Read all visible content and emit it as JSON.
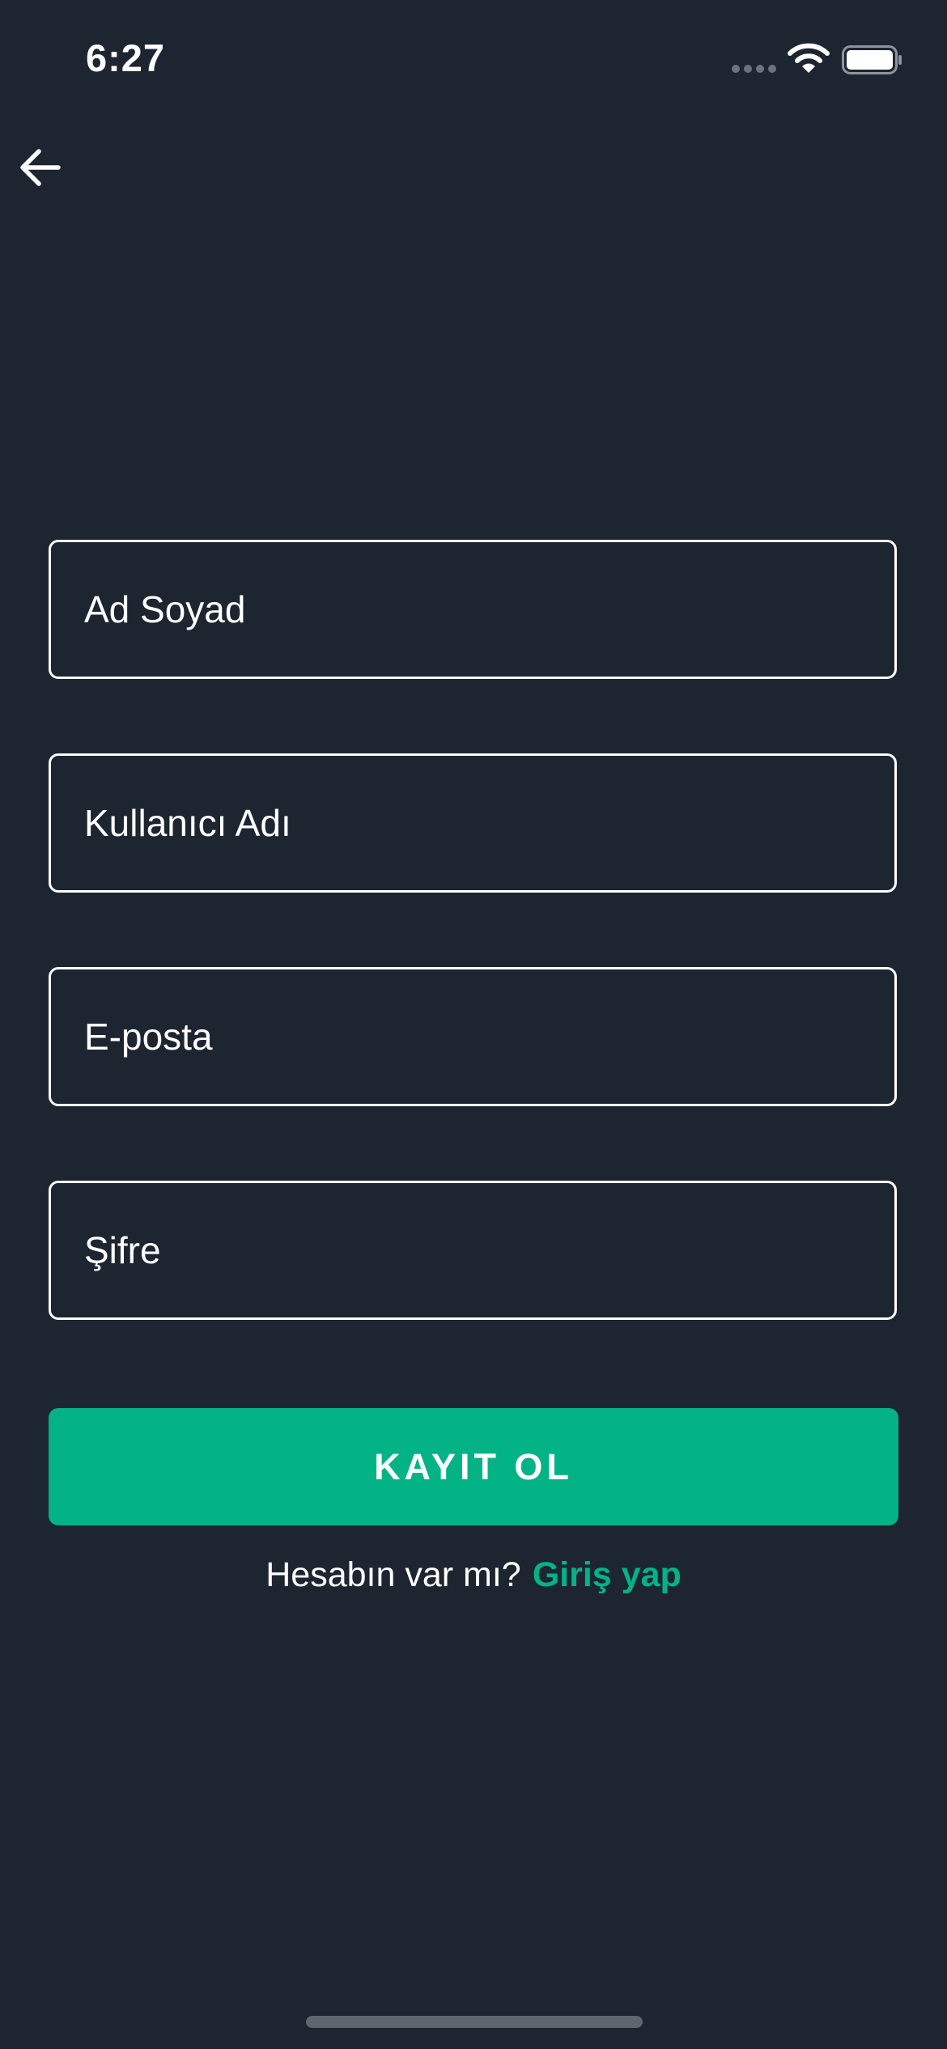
{
  "status_bar": {
    "time": "6:27"
  },
  "colors": {
    "background": "#1d2531",
    "accent": "#03b386",
    "field_border": "#ffffff"
  },
  "nav": {
    "back_icon": "arrow-left-icon"
  },
  "form": {
    "full_name": {
      "value": "",
      "placeholder": "Ad Soyad"
    },
    "username": {
      "value": "",
      "placeholder": "Kullanıcı Adı"
    },
    "email": {
      "value": "",
      "placeholder": "E-posta"
    },
    "password": {
      "value": "",
      "placeholder": "Şifre"
    },
    "submit_label": "KAYIT OL"
  },
  "login": {
    "prompt": "Hesabın var mı?",
    "link_label": "Giriş yap"
  }
}
